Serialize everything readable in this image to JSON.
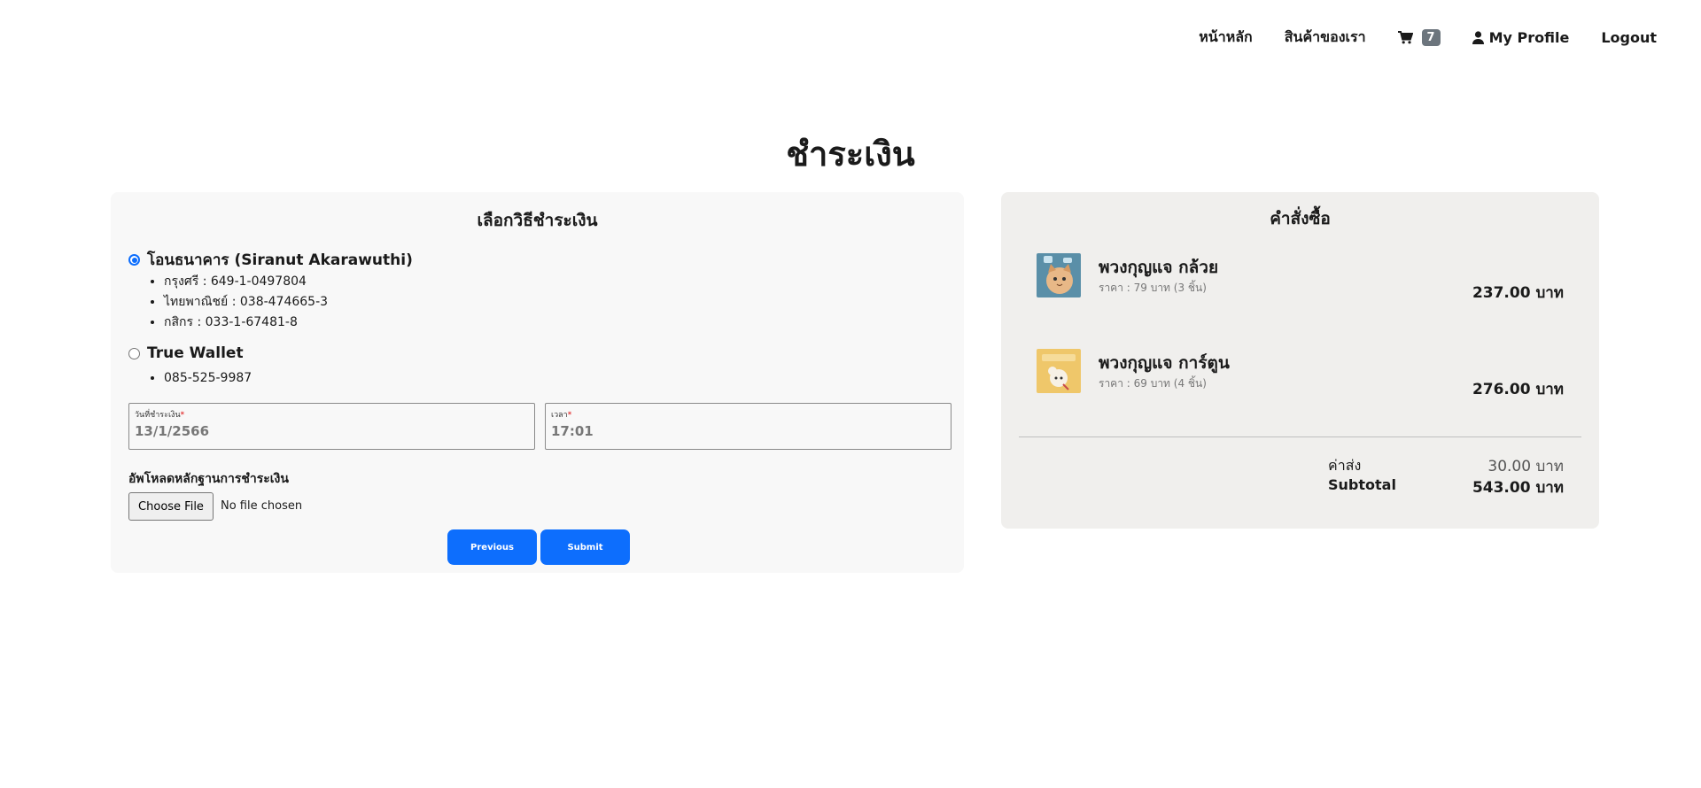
{
  "nav": {
    "home": "หน้าหลัก",
    "products": "สินค้าของเรา",
    "cart_count": "7",
    "profile": "My Profile",
    "logout": "Logout"
  },
  "page_title": "ชำระเงิน",
  "payment": {
    "title": "เลือกวิธีชำระเงิน",
    "methods": [
      {
        "label": "โอนธนาคาร (Siranut Akarawuthi)",
        "selected": true,
        "accounts": [
          "กรุงศรี : 649-1-0497804",
          "ไทยพาณิชย์ : 038-474665-3",
          "กสิกร : 033-1-67481-8"
        ]
      },
      {
        "label": "True Wallet",
        "selected": false,
        "accounts": [
          "085-525-9987"
        ]
      }
    ],
    "date_field": {
      "label": "วันที่ชำระเงิน",
      "required_mark": "*",
      "value": "13/1/2566"
    },
    "time_field": {
      "label": "เวลา",
      "required_mark": "*",
      "value": "17:01"
    },
    "upload_label": "อัพโหลดหลักฐานการชำระเงิน",
    "file_button": "Choose File",
    "file_status": "No file chosen",
    "previous_label": "Previous",
    "submit_label": "Submit"
  },
  "order": {
    "title": "คำสั่งซื้อ",
    "items": [
      {
        "name": "พวงกุญแจ กล้วย",
        "detail": "ราคา : 79 บาท (3 ชิ้น)",
        "total": "237.00 บาท"
      },
      {
        "name": "พวงกุญแจ การ์ตูน",
        "detail": "ราคา : 69 บาท (4 ชิ้น)",
        "total": "276.00 บาท"
      }
    ],
    "shipping_label": "ค่าส่ง",
    "shipping_value": "30.00 บาท",
    "subtotal_label": "Subtotal",
    "subtotal_value": "543.00 บาท"
  },
  "colors": {
    "primary": "#0d6efd",
    "badge": "#6c757d",
    "panel_left": "#f8f8f8",
    "panel_right": "#f0efed"
  }
}
